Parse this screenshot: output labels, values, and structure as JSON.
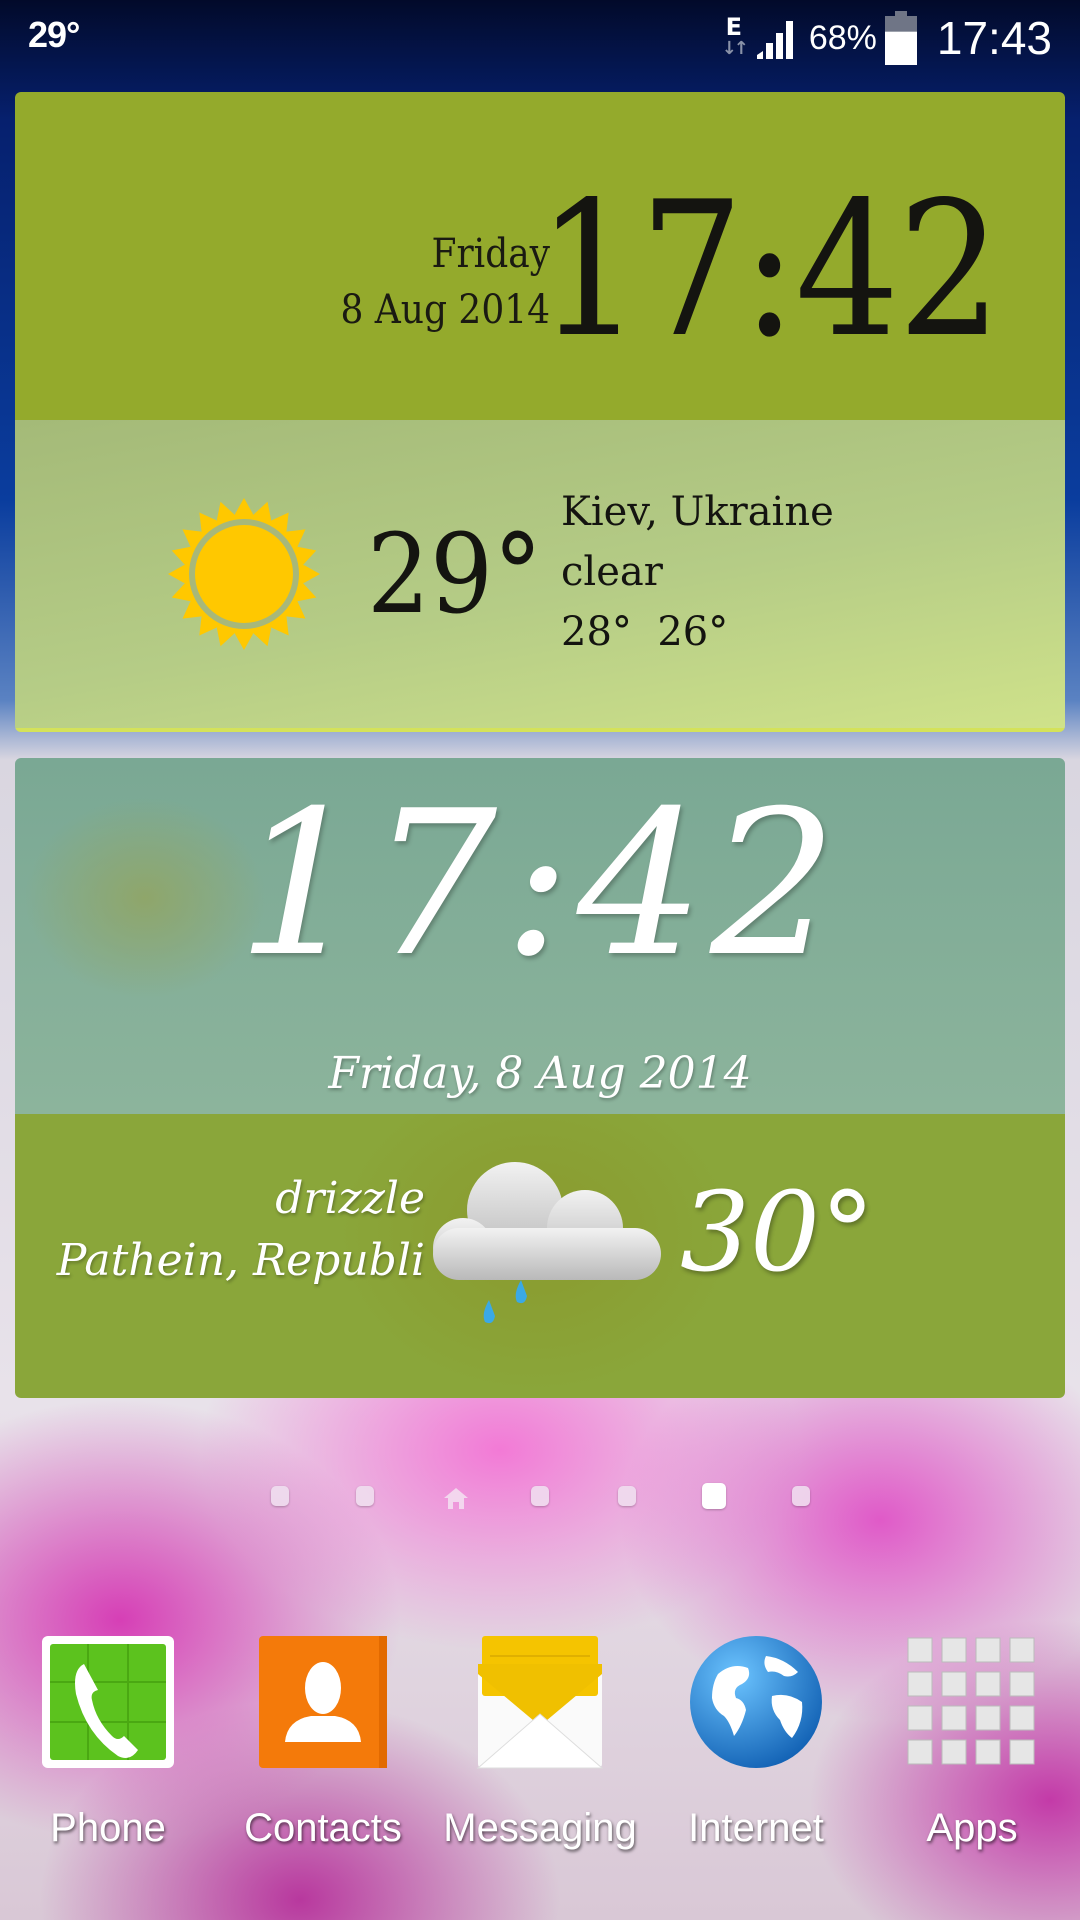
{
  "status_bar": {
    "weather_temp": "29°",
    "network_type": "E",
    "network_arrows": "↓↑",
    "battery_percent": "68%",
    "battery_level": 0.68,
    "time": "17:43"
  },
  "clock_widget": {
    "day": "Friday",
    "date": "8 Aug 2014",
    "time": "17:42",
    "weather": {
      "icon": "sun-icon",
      "temperature": "29°",
      "location": "Kiev, Ukraine",
      "condition": "clear",
      "high_low": "28°  26°"
    },
    "colors": {
      "top": "#94aa2c",
      "sun": "#ffc800"
    }
  },
  "handwritten_widget": {
    "time": "17:42",
    "date": "Friday, 8 Aug 2014",
    "weather": {
      "icon": "rain-cloud-icon",
      "condition": "drizzle",
      "location": "Pathein, Republi",
      "temperature": "30°"
    }
  },
  "pager": {
    "pages": 7,
    "home_index": 2,
    "active_index": 5
  },
  "dock": {
    "apps": [
      {
        "label": "Phone",
        "icon": "phone-icon",
        "color": "#5cc21e"
      },
      {
        "label": "Contacts",
        "icon": "contacts-icon",
        "color": "#f47a0a"
      },
      {
        "label": "Messaging",
        "icon": "messaging-icon",
        "color": "#f5c400"
      },
      {
        "label": "Internet",
        "icon": "globe-icon",
        "color": "#1e7fd0"
      },
      {
        "label": "Apps",
        "icon": "apps-grid-icon",
        "color": "#e6e6e6"
      }
    ]
  }
}
